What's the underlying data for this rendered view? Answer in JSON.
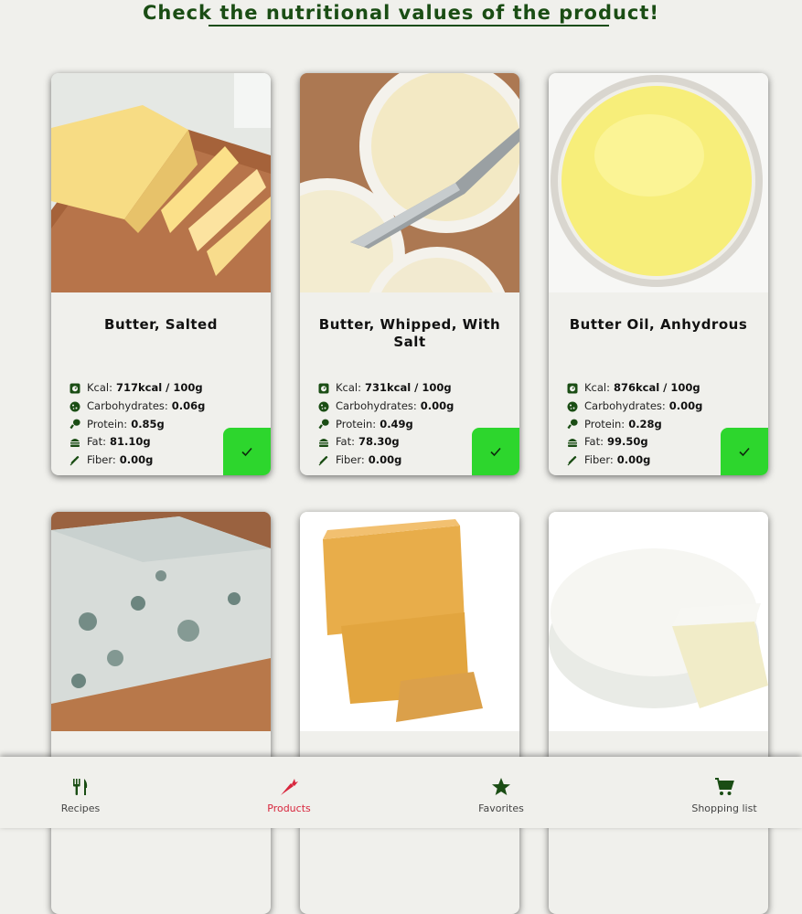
{
  "header": {
    "title": "Check the nutritional values of the product!"
  },
  "colors": {
    "brand_green": "#1a4d14",
    "check_green": "#2dd62d",
    "active_red": "#d8263d",
    "background": "#f0f0ec"
  },
  "nutrient_labels": {
    "kcal": "Kcal:",
    "carbs": "Carbohydrates:",
    "protein": "Protein:",
    "fat": "Fat:",
    "fiber": "Fiber:"
  },
  "products": [
    {
      "name": "Butter, Salted",
      "image": "butter-block",
      "kcal": "717kcal / 100g",
      "carbs": "0.06g",
      "protein": "0.85g",
      "fat": "81.10g",
      "fiber": "0.00g",
      "selected": true
    },
    {
      "name": "Butter, Whipped, With Salt",
      "image": "whipped-butter",
      "kcal": "731kcal / 100g",
      "carbs": "0.00g",
      "protein": "0.49g",
      "fat": "78.30g",
      "fiber": "0.00g",
      "selected": true
    },
    {
      "name": "Butter Oil, Anhydrous",
      "image": "butter-oil",
      "kcal": "876kcal / 100g",
      "carbs": "0.00g",
      "protein": "0.28g",
      "fat": "99.50g",
      "fiber": "0.00g",
      "selected": true
    },
    {
      "image": "blue-cheese"
    },
    {
      "image": "orange-cheese"
    },
    {
      "image": "brie-cheese"
    }
  ],
  "nav": {
    "items": [
      {
        "label": "Recipes",
        "icon": "utensils-icon",
        "active": false
      },
      {
        "label": "Products",
        "icon": "carrot-icon",
        "active": true
      },
      {
        "label": "Favorites",
        "icon": "star-icon",
        "active": false
      },
      {
        "label": "Shopping list",
        "icon": "cart-icon",
        "active": false
      }
    ]
  }
}
